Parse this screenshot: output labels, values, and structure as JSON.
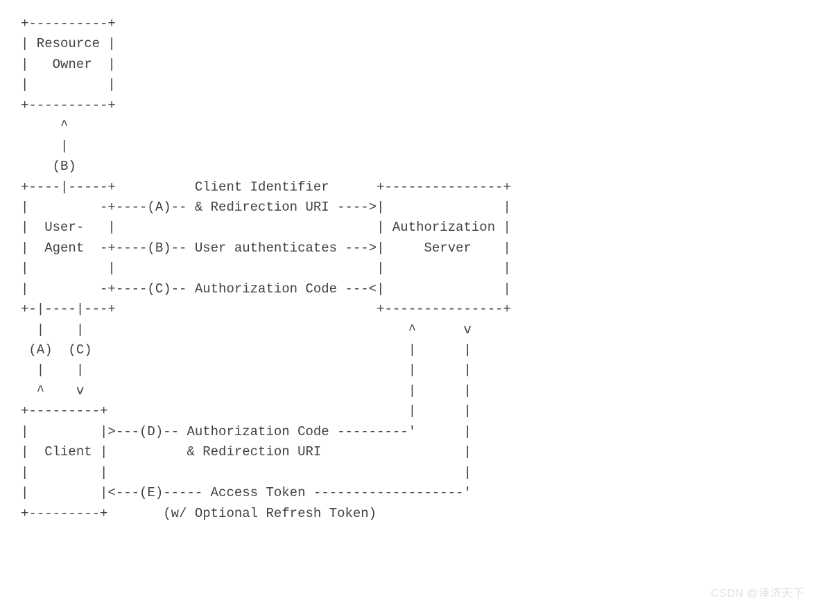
{
  "diagram": {
    "lines": [
      "+----------+",
      "| Resource |",
      "|   Owner  |",
      "|          |",
      "+----------+",
      "     ^",
      "     |",
      "    (B)",
      "+----|-----+          Client Identifier      +---------------+",
      "|         -+----(A)-- & Redirection URI ---->|               |",
      "|  User-   |                                 | Authorization |",
      "|  Agent  -+----(B)-- User authenticates --->|     Server    |",
      "|          |                                 |               |",
      "|         -+----(C)-- Authorization Code ---<|               |",
      "+-|----|---+                                 +---------------+",
      "  |    |                                         ^      v",
      " (A)  (C)                                        |      |",
      "  |    |                                         |      |",
      "  ^    v                                         |      |",
      "+---------+                                      |      |",
      "|         |>---(D)-- Authorization Code ---------'      |",
      "|  Client |          & Redirection URI                  |",
      "|         |                                             |",
      "|         |<---(E)----- Access Token -------------------'",
      "+---------+       (w/ Optional Refresh Token)"
    ]
  },
  "watermark": "CSDN @泽济天下"
}
